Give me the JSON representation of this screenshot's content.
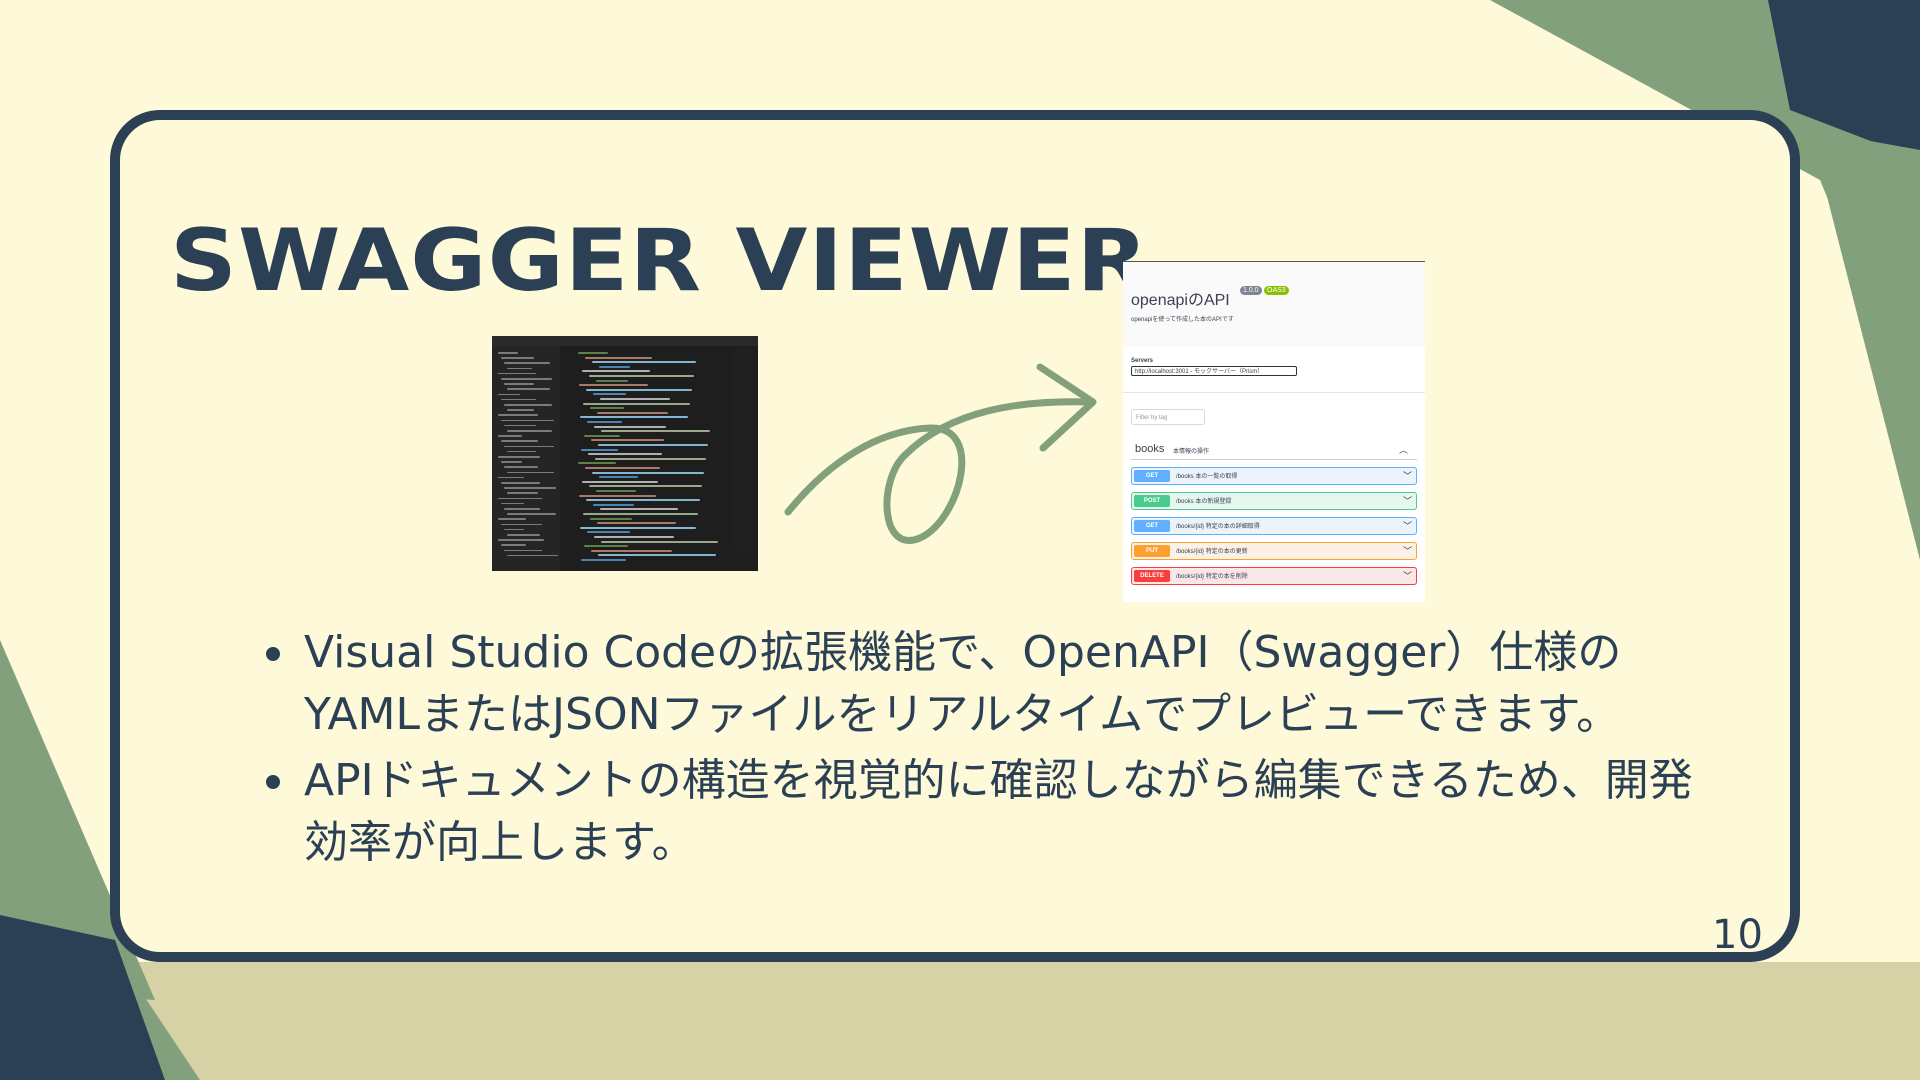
{
  "slide": {
    "title": "SWAGGER VIEWER",
    "page_number": "10",
    "bullets": [
      "Visual Studio Codeの拡張機能で、OpenAPI（Swagger）仕様のYAMLまたはJSONファイルをリアルタイムでプレビューできます。",
      "APIドキュメントの構造を視覚的に確認しながら編集できるため、開発効率が向上します。"
    ]
  },
  "colors": {
    "background": "#fdf9d9",
    "navy": "#2b4055",
    "sage": "#83a07c",
    "khaki": "#d6d2a6"
  },
  "swagger_preview": {
    "title": "openapiのAPI",
    "version_badge": "1.0.0",
    "oas_badge": "OAS3",
    "description": "openapiを使って作成した本のAPIです",
    "servers_label": "Servers",
    "server_value": "http://localhost:3001 - モックサーバー（Prism）",
    "filter_placeholder": "Filter by tag",
    "tag_name": "books",
    "tag_description": "本情報の操作",
    "operations": [
      {
        "method": "GET",
        "path": "/books  本の一覧の取得"
      },
      {
        "method": "POST",
        "path": "/books  本の新規登録"
      },
      {
        "method": "GET",
        "path": "/books/{id}  特定の本の詳細取得"
      },
      {
        "method": "PUT",
        "path": "/books/{id}  特定の本の更新"
      },
      {
        "method": "DELETE",
        "path": "/books/{id}  特定の本を削除"
      }
    ]
  }
}
